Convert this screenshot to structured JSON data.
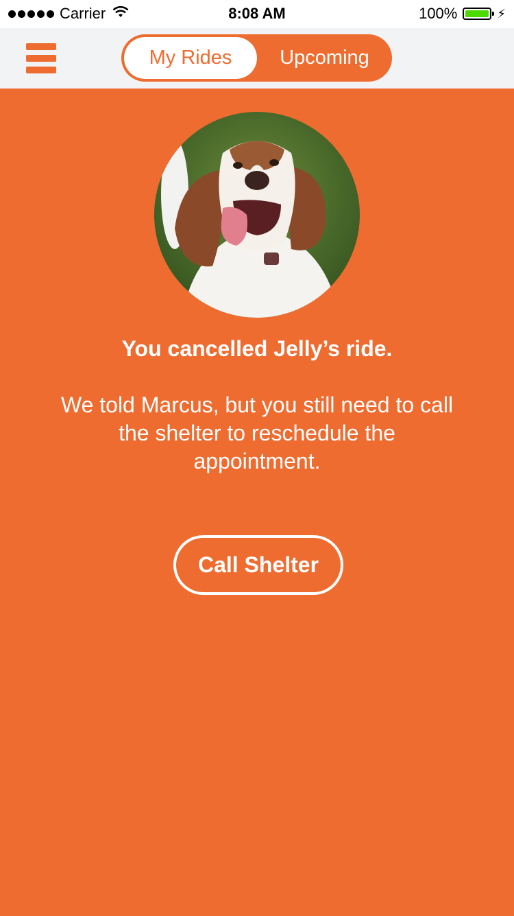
{
  "status_bar": {
    "carrier": "Carrier",
    "time": "8:08 AM",
    "battery": "100%"
  },
  "nav": {
    "menu_icon": "hamburger-menu-icon",
    "tabs": [
      {
        "label": "My Rides",
        "active": true
      },
      {
        "label": "Upcoming",
        "active": false
      }
    ]
  },
  "main": {
    "avatar_subject": "dog photo",
    "title": "You cancelled Jelly’s ride.",
    "message": "We told Marcus, but you still need to call the shelter to reschedule the appointment.",
    "button_label": "Call Shelter"
  },
  "colors": {
    "accent": "#ee6c30",
    "navbar_bg": "#f2f3f5",
    "battery_fill": "#4cd900"
  }
}
